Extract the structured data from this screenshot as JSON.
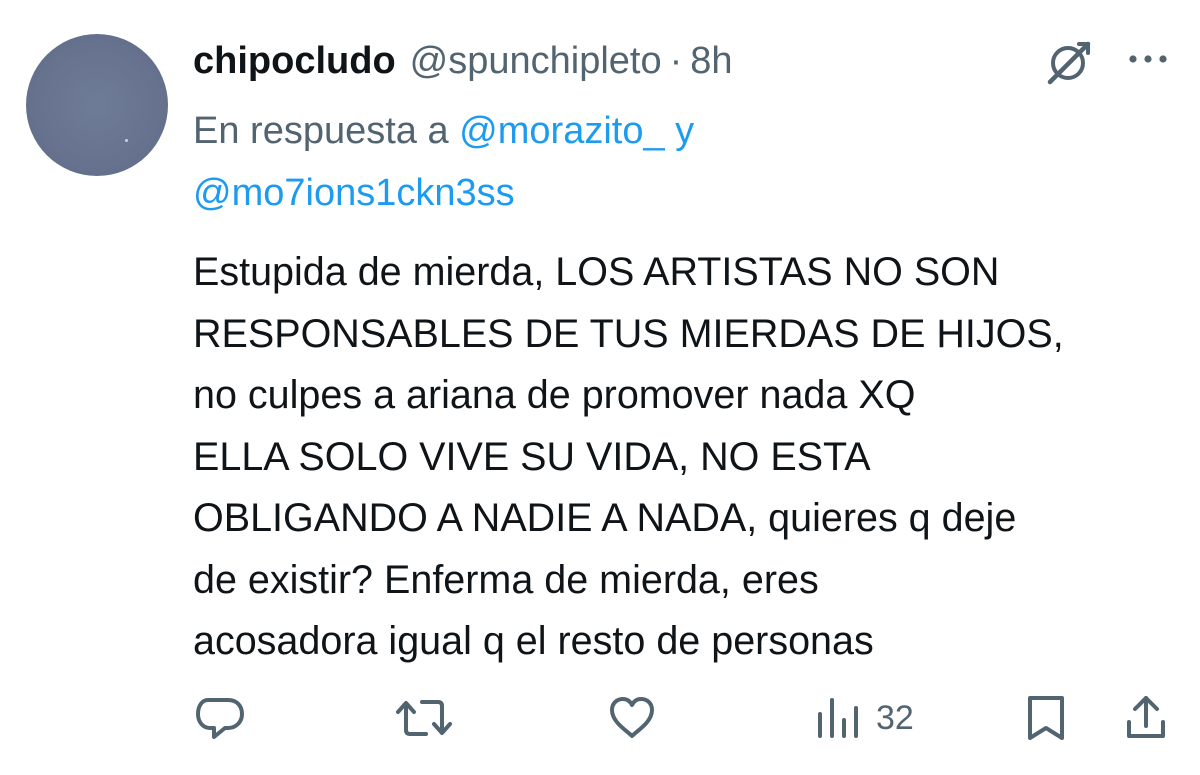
{
  "tweet": {
    "display_name": "chipocludo",
    "handle": "@spunchipleto",
    "separator": "·",
    "time": "8h",
    "reply_prefix": "En respuesta a",
    "reply_mention_1": "@morazito_",
    "reply_conjunction": "y",
    "reply_mention_2": "@mo7ions1ckn3ss",
    "body_lines": [
      "Estupida de mierda, LOS ARTISTAS NO SON",
      "RESPONSABLES DE TUS MIERDAS DE HIJOS,",
      "no culpes a ariana de promover nada XQ",
      "ELLA SOLO VIVE SU VIDA, NO ESTA",
      "OBLIGANDO A NADIE A NADA, quieres q deje",
      "de existir? Enferma de mierda, eres",
      "acosadora igual q el resto de personas"
    ],
    "views_count": "32"
  },
  "icons": {
    "grok": "grok-icon",
    "more": "more-dots-icon",
    "reply": "reply-bubble-icon",
    "repost": "repost-icon",
    "like": "heart-icon",
    "views": "views-bar-chart-icon",
    "bookmark": "bookmark-icon",
    "share": "share-upload-icon"
  },
  "colors": {
    "text_primary": "#0f1419",
    "text_secondary": "#536471",
    "link": "#1d9bf0",
    "avatar": "#66728e"
  }
}
